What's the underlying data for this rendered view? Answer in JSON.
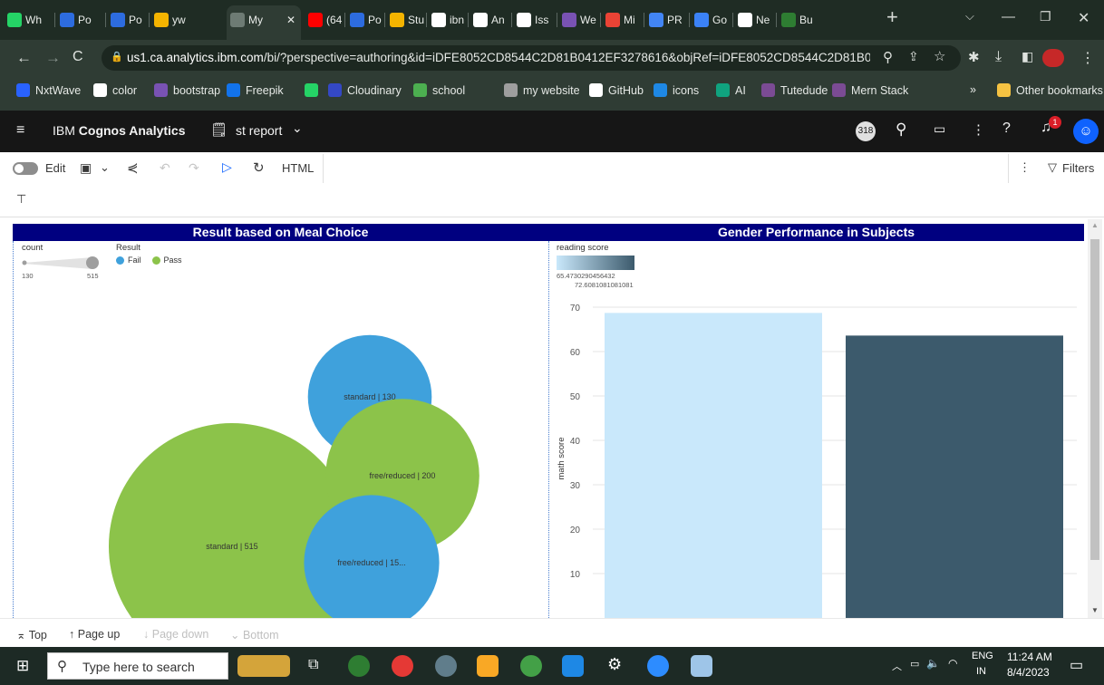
{
  "browser": {
    "tabs": [
      {
        "label": "Wh",
        "icon": "whatsapp-icon",
        "color": "#25d366"
      },
      {
        "label": "Po",
        "icon": "z-icon",
        "color": "#2d6cdf"
      },
      {
        "label": "Po",
        "icon": "z-icon",
        "color": "#2d6cdf"
      },
      {
        "label": "yw",
        "icon": "drive-icon",
        "color": "#f4b400"
      },
      {
        "label": "My",
        "icon": "cognos-icon",
        "color": "#6e7b74"
      },
      {
        "label": "(64",
        "icon": "youtube-icon",
        "color": "#ff0000"
      },
      {
        "label": "Po",
        "icon": "z-icon",
        "color": "#2d6cdf"
      },
      {
        "label": "Stu",
        "icon": "drive-icon",
        "color": "#f4b400"
      },
      {
        "label": "ibn",
        "icon": "google-icon",
        "color": "#ffffff"
      },
      {
        "label": "An",
        "icon": "github-icon",
        "color": "#ffffff"
      },
      {
        "label": "Iss",
        "icon": "github-icon",
        "color": "#ffffff"
      },
      {
        "label": "We",
        "icon": "bootstrap-icon",
        "color": "#7952b3"
      },
      {
        "label": "Mi",
        "icon": "gmail-icon",
        "color": "#ea4335"
      },
      {
        "label": "PR",
        "icon": "docs-icon",
        "color": "#4285f4"
      },
      {
        "label": "Go",
        "icon": "g-icon",
        "color": "#3b82f6"
      },
      {
        "label": "Ne",
        "icon": "openai-icon",
        "color": "#ffffff"
      },
      {
        "label": "Bu",
        "icon": "th-icon",
        "color": "#2e7d32"
      }
    ],
    "new_tab": "+",
    "url_host": "us1.ca.analytics.ibm.com",
    "url_path": "/bi/?perspective=authoring&id=iDFE8052CD8544C2D81B0412EF3278616&objRef=iDFE8052CD8544C2D81B0412...",
    "bookmarks": [
      {
        "label": "NxtWave",
        "icon": "nxtwave-icon",
        "color": "#2962ff"
      },
      {
        "label": "color",
        "icon": "google-icon",
        "color": "#ffffff"
      },
      {
        "label": "bootstrap",
        "icon": "bootstrap-icon",
        "color": "#7952b3"
      },
      {
        "label": "Freepik",
        "icon": "freepik-icon",
        "color": "#1273eb"
      },
      {
        "label": "",
        "icon": "whatsapp-icon",
        "color": "#25d366"
      },
      {
        "label": "Cloudinary",
        "icon": "cloudinary-icon",
        "color": "#3448c5"
      },
      {
        "label": "school",
        "icon": "school-icon",
        "color": "#4caf50"
      },
      {
        "label": "my website",
        "icon": "globe-icon",
        "color": "#9e9e9e"
      },
      {
        "label": "GitHub",
        "icon": "github-icon",
        "color": "#ffffff"
      },
      {
        "label": "icons",
        "icon": "icons-icon",
        "color": "#1e88e5"
      },
      {
        "label": "AI",
        "icon": "ai-icon",
        "color": "#10a37f"
      },
      {
        "label": "Tutedude",
        "icon": "folder-icon",
        "color": "#7b4b94"
      },
      {
        "label": "Mern Stack",
        "icon": "folder-icon",
        "color": "#7b4b94"
      }
    ],
    "more_bookmarks": "»",
    "other_bookmarks": "Other bookmarks"
  },
  "cognos": {
    "brand_light": "IBM ",
    "brand_bold": "Cognos Analytics",
    "report_name": "st report",
    "notif_count": "1",
    "user_badge": "318"
  },
  "toolbar": {
    "edit_label": "Edit",
    "html_label": "HTML",
    "filters_label": "Filters"
  },
  "report": {
    "left_title": "Result based on Meal Choice",
    "right_title": "Gender Performance in Subjects",
    "size_legend_title": "count",
    "size_min": "130",
    "size_max": "515",
    "color_legend_title": "Result",
    "legend_fail": "Fail",
    "legend_pass": "Pass",
    "gradient_title": "reading score",
    "gradient_min": "65.4730290456432",
    "gradient_max": "72.6081081081081",
    "pass_color": "#8cc34a",
    "fail_color": "#3fa1dc"
  },
  "chart_data": [
    {
      "type": "bubble",
      "title": "Result based on Meal Choice",
      "size_field": "count",
      "color_field": "Result",
      "bubbles": [
        {
          "lunch": "standard",
          "result": "Pass",
          "count": 515,
          "label": "standard | 515"
        },
        {
          "lunch": "standard",
          "result": "Fail",
          "count": 130,
          "label": "standard | 130"
        },
        {
          "lunch": "free/reduced",
          "result": "Pass",
          "count": 200,
          "label": "free/reduced | 200"
        },
        {
          "lunch": "free/reduced",
          "result": "Fail",
          "count": 155,
          "label": "free/reduced | 15..."
        }
      ]
    },
    {
      "type": "bar",
      "title": "Gender Performance in Subjects",
      "ylabel": "math score",
      "color_field": "reading score",
      "ylim": [
        0,
        72
      ],
      "yticks": [
        10,
        20,
        30,
        40,
        50,
        60,
        70
      ],
      "values": [
        68.7,
        63.6
      ],
      "colors": [
        "#c9e8fb",
        "#3c5a6c"
      ]
    }
  ],
  "pagenav": {
    "top": "Top",
    "page_up": "Page up",
    "page_down": "Page down",
    "bottom": "Bottom"
  },
  "taskbar": {
    "search_placeholder": "Type here to search",
    "lang1": "ENG",
    "lang2": "IN",
    "time": "11:24 AM",
    "date": "8/4/2023"
  }
}
